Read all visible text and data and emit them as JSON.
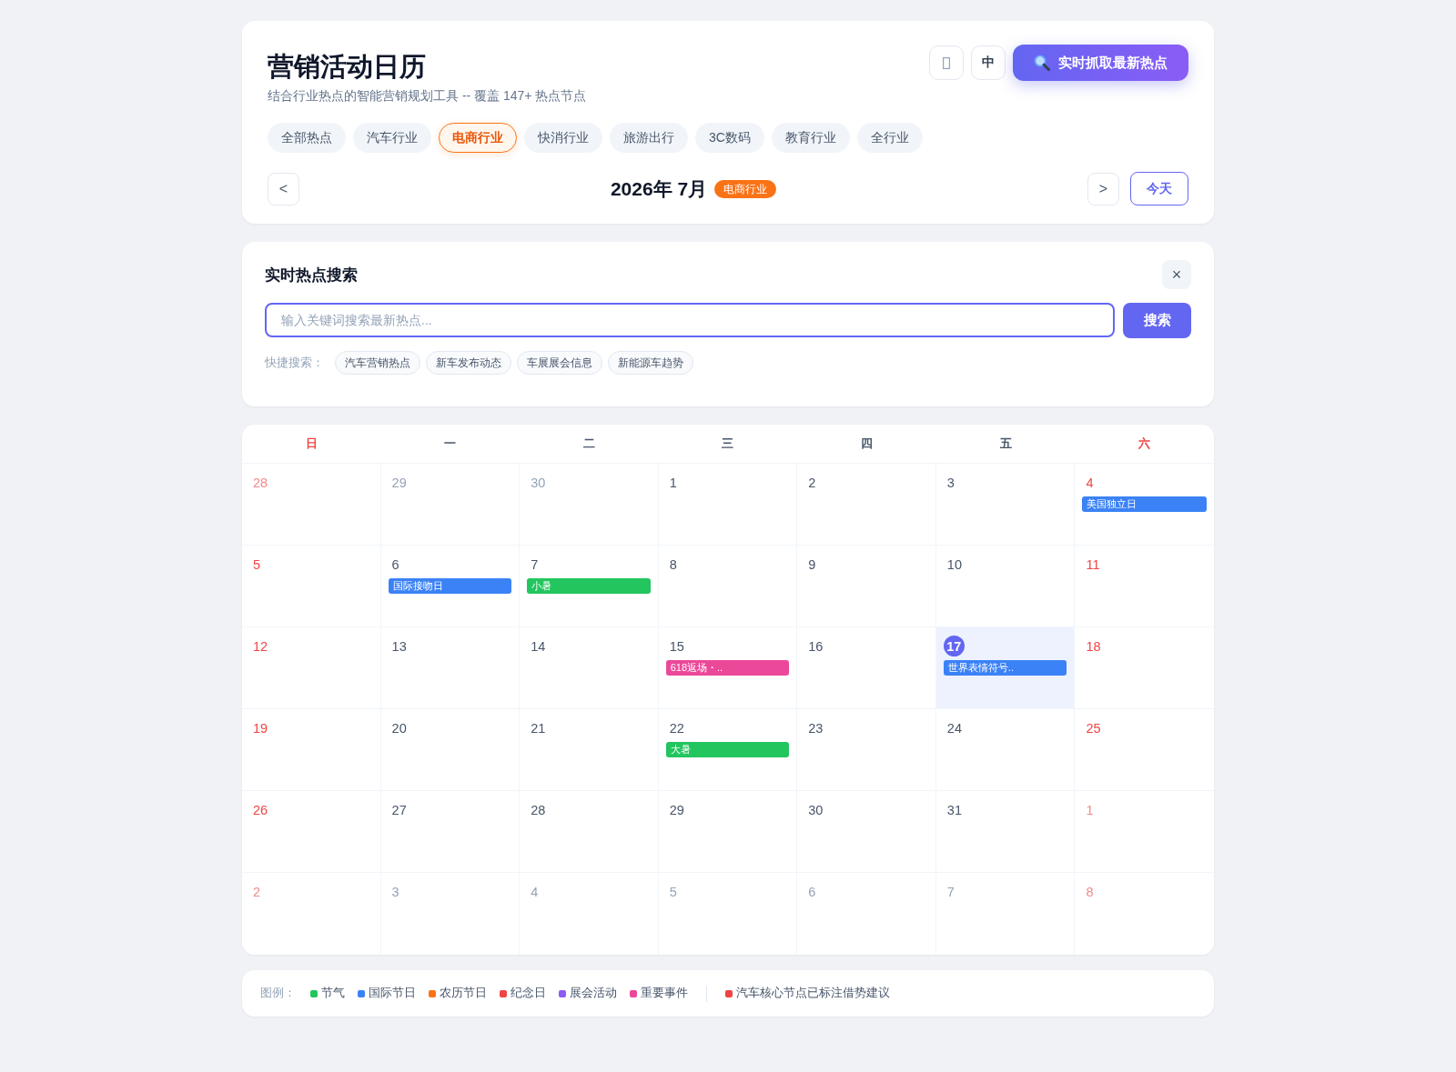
{
  "header": {
    "title": "营销活动日历",
    "subtitle": "结合行业热点的智能营销规划工具 -- 覆盖 147+ 热点节点",
    "lang_button": "中",
    "fetch_button": "实时抓取最新热点"
  },
  "industry_tabs": [
    {
      "label": "全部热点",
      "selected": false
    },
    {
      "label": "汽车行业",
      "selected": false
    },
    {
      "label": "电商行业",
      "selected": true
    },
    {
      "label": "快消行业",
      "selected": false
    },
    {
      "label": "旅游出行",
      "selected": false
    },
    {
      "label": "3C数码",
      "selected": false
    },
    {
      "label": "教育行业",
      "selected": false
    },
    {
      "label": "全行业",
      "selected": false
    }
  ],
  "month_nav": {
    "prev": "<",
    "title": "2026年 7月",
    "badge": "电商行业",
    "next": ">",
    "today_button": "今天"
  },
  "search_panel": {
    "title": "实时热点搜索",
    "close": "×",
    "placeholder": "输入关键词搜索最新热点...",
    "button": "搜索",
    "quick_label": "快捷搜索：",
    "quick_chips": [
      "汽车营销热点",
      "新车发布动态",
      "车展展会信息",
      "新能源车趋势"
    ]
  },
  "calendar": {
    "weekdays": [
      {
        "label": "日",
        "weekend": true
      },
      {
        "label": "一",
        "weekend": false
      },
      {
        "label": "二",
        "weekend": false
      },
      {
        "label": "三",
        "weekend": false
      },
      {
        "label": "四",
        "weekend": false
      },
      {
        "label": "五",
        "weekend": false
      },
      {
        "label": "六",
        "weekend": true
      }
    ],
    "weeks": [
      [
        {
          "day": "28",
          "outside": true,
          "today": false
        },
        {
          "day": "29",
          "outside": true,
          "today": false
        },
        {
          "day": "30",
          "outside": true,
          "today": false
        },
        {
          "day": "1",
          "outside": false,
          "today": false
        },
        {
          "day": "2",
          "outside": false,
          "today": false
        },
        {
          "day": "3",
          "outside": false,
          "today": false
        },
        {
          "day": "4",
          "outside": false,
          "today": false,
          "events": [
            {
              "label": "美国独立日",
              "color": "#3b82f6"
            }
          ]
        }
      ],
      [
        {
          "day": "5",
          "outside": false,
          "today": false
        },
        {
          "day": "6",
          "outside": false,
          "today": false,
          "events": [
            {
              "label": "国际接吻日",
              "color": "#3b82f6"
            }
          ]
        },
        {
          "day": "7",
          "outside": false,
          "today": false,
          "events": [
            {
              "label": "小暑",
              "color": "#22c55e"
            }
          ]
        },
        {
          "day": "8",
          "outside": false,
          "today": false
        },
        {
          "day": "9",
          "outside": false,
          "today": false
        },
        {
          "day": "10",
          "outside": false,
          "today": false
        },
        {
          "day": "11",
          "outside": false,
          "today": false
        }
      ],
      [
        {
          "day": "12",
          "outside": false,
          "today": false
        },
        {
          "day": "13",
          "outside": false,
          "today": false
        },
        {
          "day": "14",
          "outside": false,
          "today": false
        },
        {
          "day": "15",
          "outside": false,
          "today": false,
          "events": [
            {
              "label": "618返场・..",
              "color": "#ec4899"
            }
          ]
        },
        {
          "day": "16",
          "outside": false,
          "today": false
        },
        {
          "day": "17",
          "outside": false,
          "today": true,
          "events": [
            {
              "label": "世界表情符号..",
              "color": "#3b82f6"
            }
          ]
        },
        {
          "day": "18",
          "outside": false,
          "today": false
        }
      ],
      [
        {
          "day": "19",
          "outside": false,
          "today": false
        },
        {
          "day": "20",
          "outside": false,
          "today": false
        },
        {
          "day": "21",
          "outside": false,
          "today": false
        },
        {
          "day": "22",
          "outside": false,
          "today": false,
          "events": [
            {
              "label": "大暑",
              "color": "#22c55e"
            }
          ]
        },
        {
          "day": "23",
          "outside": false,
          "today": false
        },
        {
          "day": "24",
          "outside": false,
          "today": false
        },
        {
          "day": "25",
          "outside": false,
          "today": false
        }
      ],
      [
        {
          "day": "26",
          "outside": false,
          "today": false
        },
        {
          "day": "27",
          "outside": false,
          "today": false
        },
        {
          "day": "28",
          "outside": false,
          "today": false
        },
        {
          "day": "29",
          "outside": false,
          "today": false
        },
        {
          "day": "30",
          "outside": false,
          "today": false
        },
        {
          "day": "31",
          "outside": false,
          "today": false
        },
        {
          "day": "1",
          "outside": true,
          "today": false
        }
      ],
      [
        {
          "day": "2",
          "outside": true,
          "today": false
        },
        {
          "day": "3",
          "outside": true,
          "today": false
        },
        {
          "day": "4",
          "outside": true,
          "today": false
        },
        {
          "day": "5",
          "outside": true,
          "today": false
        },
        {
          "day": "6",
          "outside": true,
          "today": false
        },
        {
          "day": "7",
          "outside": true,
          "today": false
        },
        {
          "day": "8",
          "outside": true,
          "today": false
        }
      ]
    ]
  },
  "legend": {
    "label": "图例：",
    "items": [
      {
        "label": "节气",
        "color": "#22c55e"
      },
      {
        "label": "国际节日",
        "color": "#3b82f6"
      },
      {
        "label": "农历节日",
        "color": "#f97316"
      },
      {
        "label": "纪念日",
        "color": "#ef4444"
      },
      {
        "label": "展会活动",
        "color": "#8b5cf6"
      },
      {
        "label": "重要事件",
        "color": "#ec4899"
      }
    ],
    "note": {
      "label": "汽车核心节点已标注借势建议",
      "color": "#ef4444"
    }
  }
}
